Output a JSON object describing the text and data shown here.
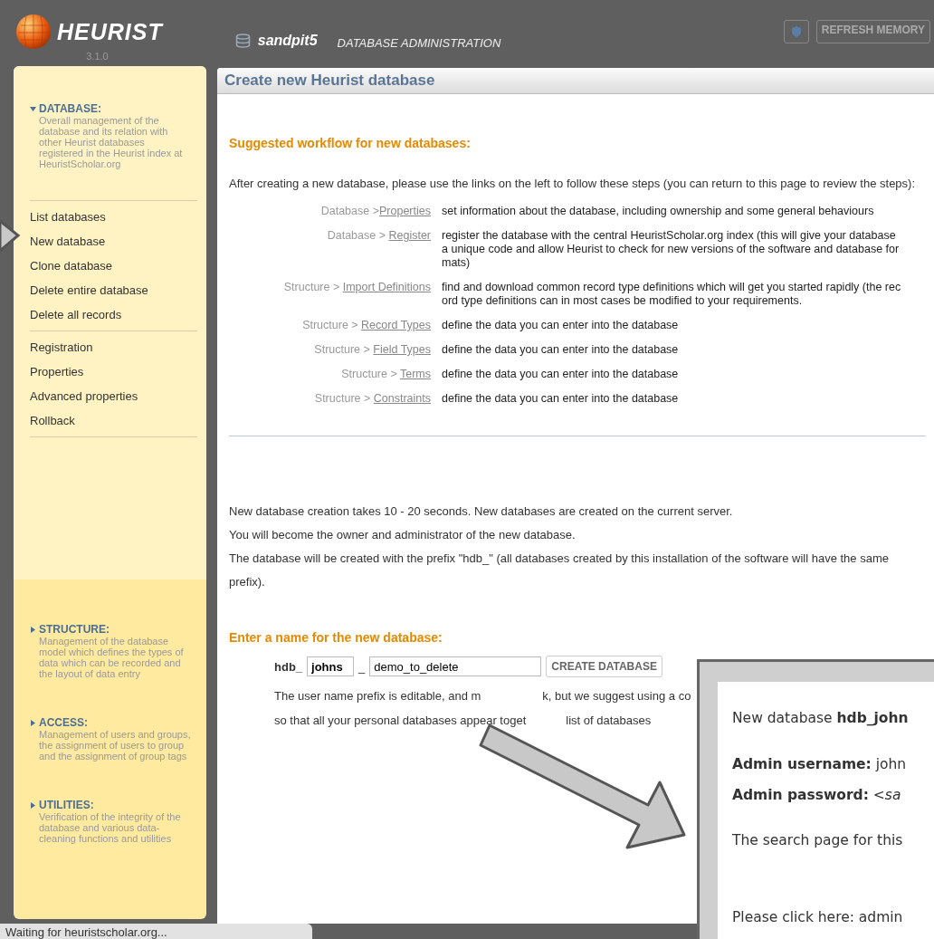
{
  "header": {
    "logo": "HEURIST",
    "version": "3.1.0",
    "database": "sandpit5",
    "section": "DATABASE ADMINISTRATION",
    "refresh_button": "REFRESH MEMORY"
  },
  "sidebar": {
    "sections": [
      {
        "title": "DATABASE:",
        "expanded": true,
        "description": "Overall management of the database and its relation with other Heurist databases registered in the Heurist index at HeuristScholar.org",
        "groups": [
          [
            "List databases",
            "New database",
            "Clone database",
            "Delete entire database",
            "Delete all records"
          ],
          [
            "Registration",
            "Properties",
            "Advanced properties",
            "Rollback"
          ]
        ]
      },
      {
        "title": "STRUCTURE:",
        "expanded": false,
        "description": "Management of the database model which defines the types of data which can be recorded and the layout of data entry"
      },
      {
        "title": "ACCESS:",
        "expanded": false,
        "description": "Management of users and groups, the assignment of users to group and the assignment of group tags"
      },
      {
        "title": "UTILITIES:",
        "expanded": false,
        "description": "Verification of the integrity of the database and various data-cleaning functions and utilities"
      }
    ]
  },
  "main": {
    "title": "Create new Heurist database",
    "workflow_heading": "Suggested workflow for new databases:",
    "intro": "After creating a new database, please use the links on the left to follow these steps (you can return to this page to review the steps):",
    "steps": [
      {
        "area": "Database >",
        "link": "Properties",
        "description": "set information about the database, including ownership and some general behaviours"
      },
      {
        "area": "Database > ",
        "link": "Register",
        "description": "register the database with the central HeuristScholar.org index (this will give your database a unique code and allow Heurist to check for new versions of the software and database formats)"
      },
      {
        "area": "Structure > ",
        "link": "Import Definitions",
        "description": "find and download common record type definitions which will get you started rapidly (the record type definitions can in most cases be modified to your requirements."
      },
      {
        "area": "Structure > ",
        "link": "Record Types",
        "description": "define the data you can enter into the database"
      },
      {
        "area": "Structure > ",
        "link": "Field Types",
        "description": "define the data you can enter into the database"
      },
      {
        "area": "Structure > ",
        "link": "Terms",
        "description": "define the data you can enter into the database"
      },
      {
        "area": "Structure > ",
        "link": "Constraints",
        "description": "define the data you can enter into the database"
      }
    ],
    "notes": [
      "New database creation takes 10 - 20 seconds. New databases are created on the current server.",
      "You will become the owner and administrator of the new database.",
      "The database will be created with the prefix \"hdb_\" (all databases created by this installation of the software will have the same prefix)."
    ],
    "name_heading": "Enter a name for the new database:",
    "form": {
      "prefix": "hdb_",
      "user": "johns",
      "separator": "_",
      "name": "demo_to_delete",
      "button": "CREATE DATABASE"
    },
    "hint_lines": [
      [
        "The user name prefix is editable, and m",
        "k, but we suggest using a co"
      ],
      [
        "so that all your personal databases appear toget",
        "list of databases"
      ]
    ]
  },
  "callout": {
    "lines": [
      "New database **hdb_john**",
      "**Admin username:** john",
      "**Admin password:** *<sa*",
      "The search page for this",
      "Please click here: admin"
    ]
  },
  "status_bar": "Waiting for heuristscholar.org..."
}
